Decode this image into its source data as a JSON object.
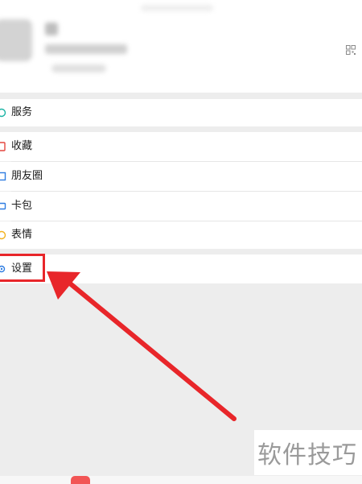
{
  "menu": {
    "items": [
      {
        "id": "services",
        "label": "服务",
        "icon": "services-icon"
      },
      {
        "id": "favorites",
        "label": "收藏",
        "icon": "favorites-icon"
      },
      {
        "id": "moments",
        "label": "朋友圈",
        "icon": "moments-icon"
      },
      {
        "id": "cards",
        "label": "卡包",
        "icon": "card-wallet-icon"
      },
      {
        "id": "stickers",
        "label": "表情",
        "icon": "sticker-icon"
      },
      {
        "id": "settings",
        "label": "设置",
        "icon": "settings-icon"
      }
    ]
  },
  "watermark": {
    "text": "软件技巧"
  },
  "colors": {
    "highlight": "#e8262a",
    "background": "#ededed",
    "row": "#ffffff",
    "watermark_text": "#9a9a9a"
  }
}
